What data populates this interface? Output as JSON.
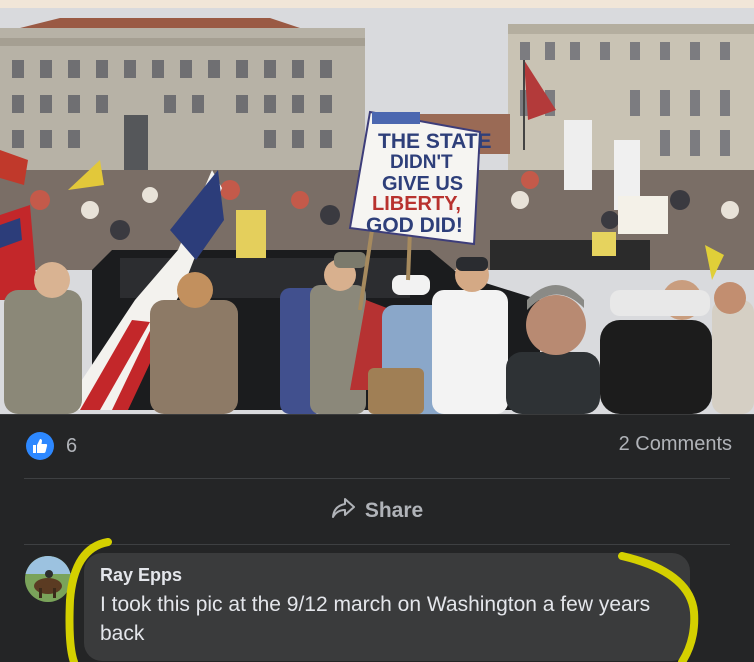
{
  "photo": {
    "sign_line1": "THE STATE",
    "sign_line2": "DIDN'T",
    "sign_line3": "GIVE US",
    "sign_line4": "LIBERTY,",
    "sign_line5": "GOD DID!"
  },
  "reactions": {
    "like_count": "6",
    "comments_label": "2 Comments"
  },
  "actions": {
    "share_label": "Share"
  },
  "comment": {
    "author": "Ray Epps",
    "text": "I took this pic at the 9/12 march on Washington a few years back"
  },
  "colors": {
    "background": "#242526",
    "like_blue": "#2d88ff",
    "highlight": "#d4d000"
  }
}
